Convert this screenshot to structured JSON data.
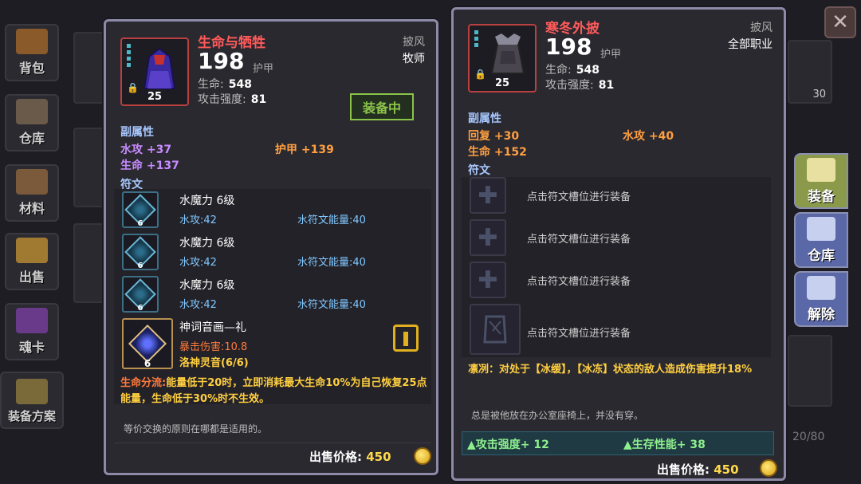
{
  "sidebar": {
    "items": [
      {
        "label": "背包"
      },
      {
        "label": "仓库"
      },
      {
        "label": "材料"
      },
      {
        "label": "出售"
      },
      {
        "label": "魂卡"
      },
      {
        "label": "装备方案"
      }
    ]
  },
  "close_label": "✕",
  "right_tabs": [
    {
      "label": "装备"
    },
    {
      "label": "仓库"
    },
    {
      "label": "解除"
    }
  ],
  "background": {
    "count_label": "30",
    "capacity_label": "20/80"
  },
  "left_item": {
    "name": "生命与牺牲",
    "armor_value": "198",
    "armor_label": "护甲",
    "hp_label": "生命:",
    "hp_value": "548",
    "atk_label": "攻击强度:",
    "atk_value": "81",
    "type": "披风",
    "class": "牧师",
    "level": "25",
    "equipped_label": "装备中",
    "sub_title": "副属性",
    "subs": [
      {
        "text": "水攻 +37",
        "color": "purple"
      },
      {
        "text": "护甲 +139",
        "color": "orange"
      },
      {
        "text": "生命 +137",
        "color": "purple"
      }
    ],
    "rune_title": "符文",
    "runes": [
      {
        "name": "水魔力 6级",
        "stat1": "水攻:42",
        "stat2": "水符文能量:40",
        "level": "6"
      },
      {
        "name": "水魔力 6级",
        "stat1": "水攻:42",
        "stat2": "水符文能量:40",
        "level": "6"
      },
      {
        "name": "水魔力 6级",
        "stat1": "水攻:42",
        "stat2": "水符文能量:40",
        "level": "6"
      }
    ],
    "special_rune": {
      "name": "神词音画—礼",
      "stat": "暴击伤害:10.8",
      "set": "洛神灵音(6/6)",
      "level": "6"
    },
    "passive_label": "生命分流:",
    "passive_text": "能量低于20时，立即消耗最大生命10%为自己恢复25点能量，生命低于30%时不生效。",
    "flavor": "等价交换的原则在哪都是适用的。",
    "price_label": "出售价格:",
    "price_value": "450"
  },
  "right_item": {
    "name": "寒冬外披",
    "armor_value": "198",
    "armor_label": "护甲",
    "hp_label": "生命:",
    "hp_value": "548",
    "atk_label": "攻击强度:",
    "atk_value": "81",
    "type": "披风",
    "class": "全部职业",
    "level": "25",
    "sub_title": "副属性",
    "subs": [
      {
        "text": "回复 +30"
      },
      {
        "text": "水攻 +40"
      },
      {
        "text": "生命 +152"
      }
    ],
    "rune_title": "符文",
    "empty_slot_text": "点击符文槽位进行装备",
    "passive_text": "凛冽：对处于【冰缓】，【冰冻】状态的敌人造成伤害提升18%",
    "flavor": "总是被他放在办公室座椅上，并没有穿。",
    "bonus1": "▲攻击强度+ 12",
    "bonus2": "▲生存性能+ 38",
    "price_label": "出售价格:",
    "price_value": "450"
  }
}
